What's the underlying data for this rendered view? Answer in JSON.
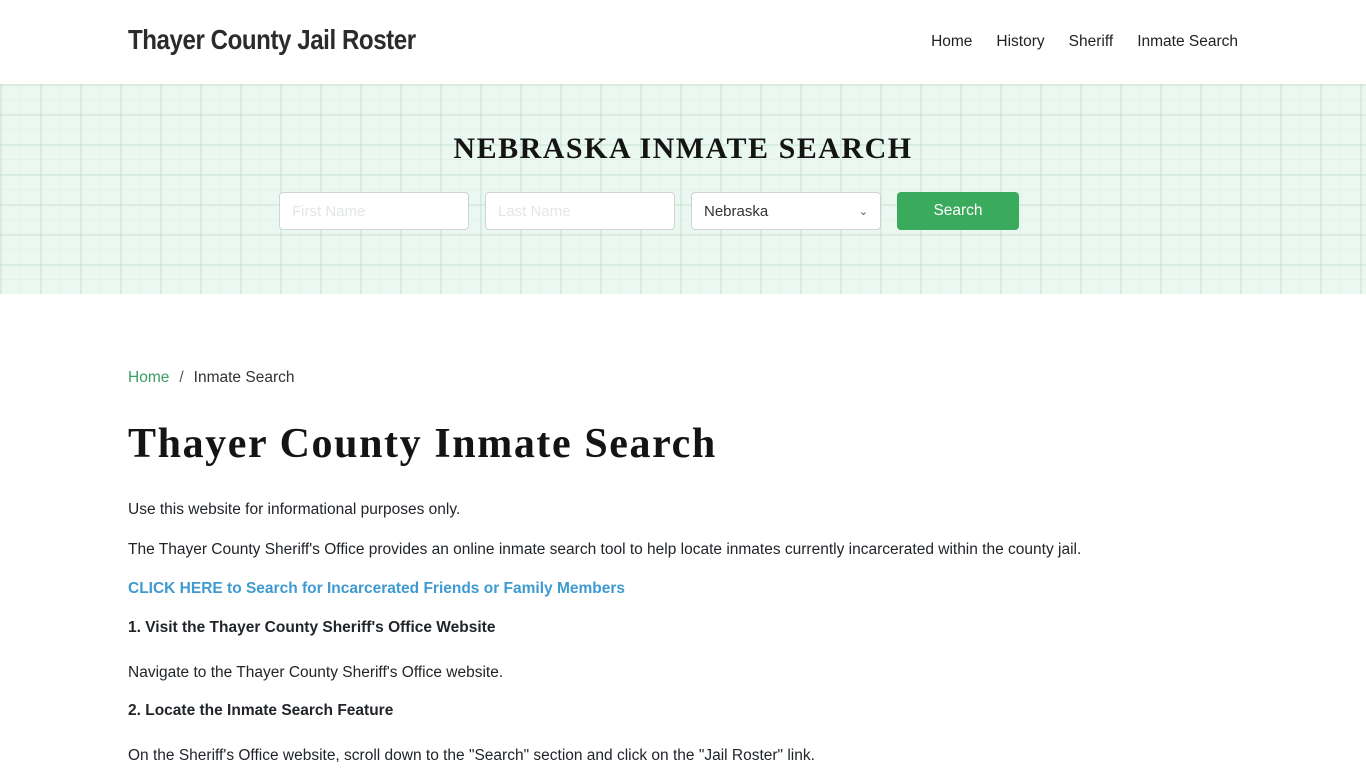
{
  "header": {
    "site_title": "Thayer County Jail Roster",
    "nav": [
      "Home",
      "History",
      "Sheriff",
      "Inmate Search"
    ]
  },
  "hero": {
    "title": "NEBRASKA INMATE SEARCH",
    "first_name_placeholder": "First Name",
    "last_name_placeholder": "Last Name",
    "state_selected": "Nebraska",
    "search_button": "Search",
    "accent_color": "#3aaa5c"
  },
  "breadcrumb": {
    "home": "Home",
    "separator": "/",
    "current": "Inmate Search"
  },
  "content": {
    "title": "Thayer County Inmate Search",
    "intro": "Use this website for informational purposes only.",
    "description": "The Thayer County Sheriff's Office provides an online inmate search tool to help locate inmates currently incarcerated within the county jail.",
    "cta_link": "CLICK HERE to Search for Incarcerated Friends or Family Members",
    "steps": [
      {
        "title": "1. Visit the Thayer County Sheriff's Office Website",
        "text": "Navigate to the Thayer County Sheriff's Office website."
      },
      {
        "title": "2. Locate the Inmate Search Feature",
        "text": "On the Sheriff's Office website, scroll down to the \"Search\" section and click on the \"Jail Roster\" link."
      }
    ]
  }
}
